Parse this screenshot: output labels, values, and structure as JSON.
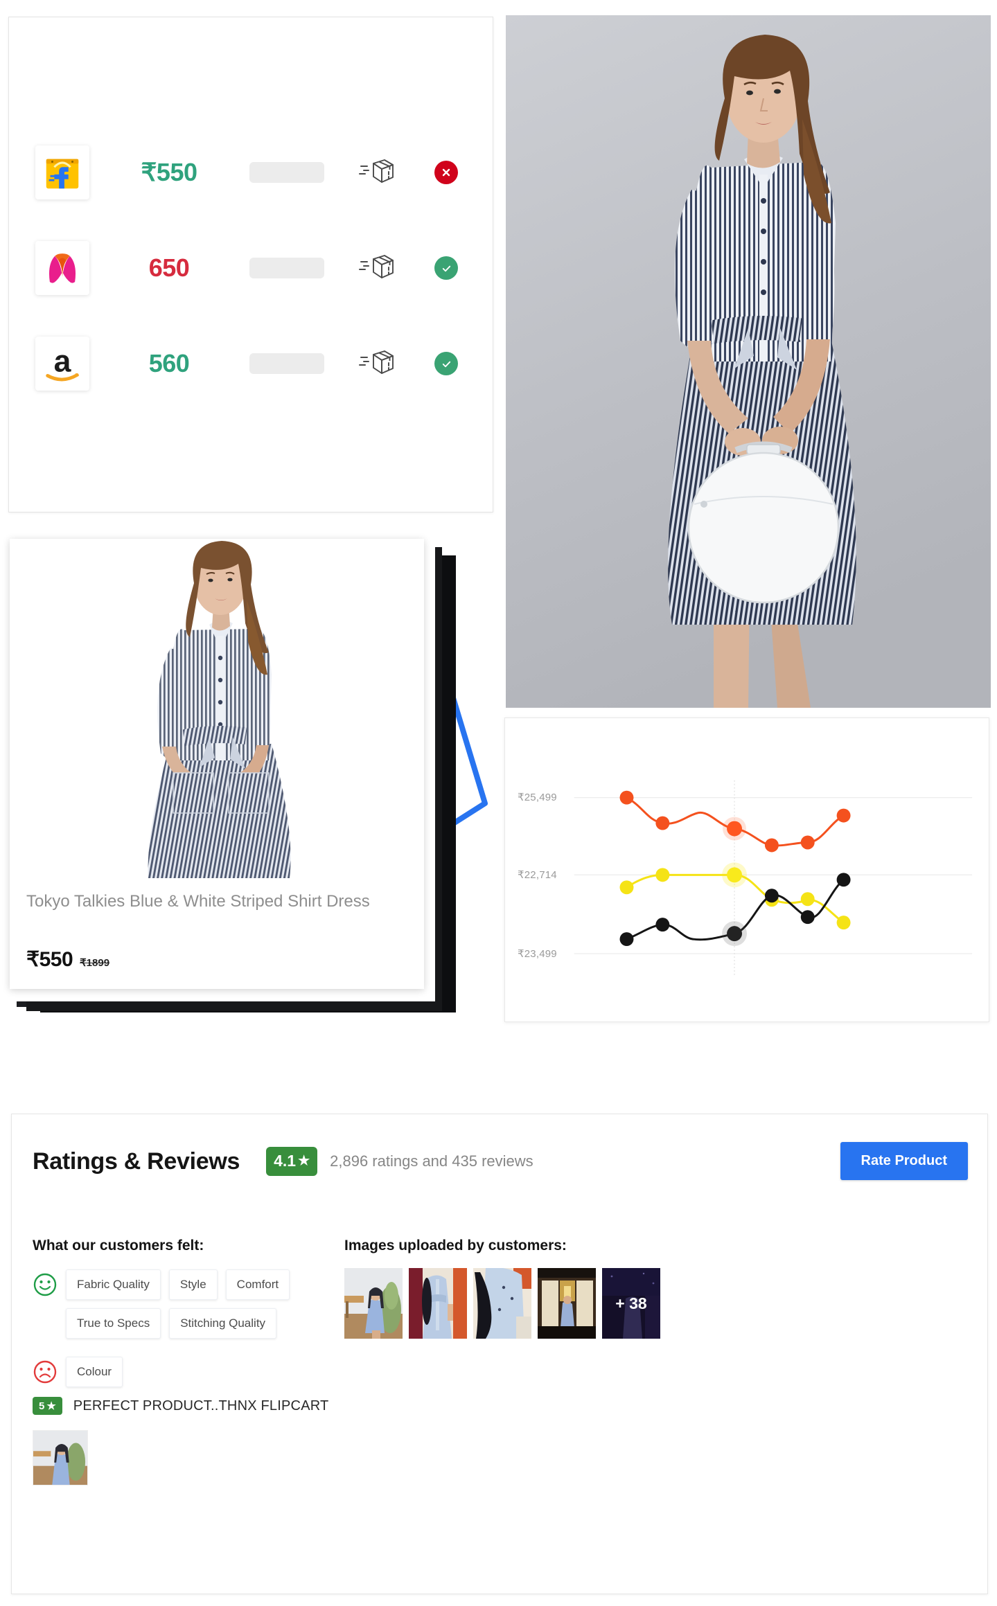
{
  "price_comparison": {
    "rows": [
      {
        "store": "flipkart",
        "store_label": "Flipkart",
        "price": "₹550",
        "price_color": "#2fa27d",
        "shipping_icon": "delivery-box-icon",
        "status": "unavailable",
        "status_icon": "cross-icon",
        "status_color": "#d0021b"
      },
      {
        "store": "myntra",
        "store_label": "Myntra",
        "price": "650",
        "price_color": "#d62b3e",
        "shipping_icon": "delivery-box-icon",
        "status": "available",
        "status_icon": "check-icon",
        "status_color": "#3aa373"
      },
      {
        "store": "amazon",
        "store_label": "Amazon",
        "price": "560",
        "price_color": "#2fa27d",
        "shipping_icon": "delivery-box-icon",
        "status": "available",
        "status_icon": "check-icon",
        "status_color": "#3aa373"
      }
    ]
  },
  "product_card": {
    "title": "Tokyo Talkies Blue & White Striped Shirt Dress",
    "price": "₹550",
    "original_price": "₹1899"
  },
  "chart_data": {
    "type": "line",
    "title": "",
    "xlabel": "",
    "ylabel": "",
    "grid": true,
    "legend_position": "none",
    "x": [
      1,
      2,
      3,
      4,
      5,
      6,
      7
    ],
    "ytick_labels": [
      "₹25,499",
      "₹22,714",
      "₹23,499"
    ],
    "ytick_values": [
      25499,
      22714,
      23499
    ],
    "series": [
      {
        "name": "Flipkart",
        "color": "#f4511e",
        "values": [
          25499,
          24950,
          25180,
          24620,
          24640,
          24640,
          25240
        ],
        "highlight_index": 2
      },
      {
        "name": "Myntra",
        "color": "#f5e316",
        "values": [
          22500,
          22714,
          22714,
          22100,
          22180,
          22130,
          21780
        ],
        "highlight_index": 2
      },
      {
        "name": "Amazon",
        "color": "#151515",
        "values": [
          21550,
          21780,
          21620,
          22180,
          21980,
          21760,
          22520
        ],
        "highlight_index": 2
      }
    ]
  },
  "reviews": {
    "title": "Ratings & Reviews",
    "rating_value": "4.1",
    "rating_star": "★",
    "rating_count_text": "2,896 ratings and 435 reviews",
    "rate_button_label": "Rate Product",
    "accent_color": "#2874f0",
    "badge_color": "#388e3c",
    "felt_label": "What our customers felt:",
    "images_label": "Images uploaded by customers:",
    "positive_icon": "smiley-happy-icon",
    "negative_icon": "smiley-sad-icon",
    "positive_tags_row1": [
      "Fabric Quality",
      "Style",
      "Comfort"
    ],
    "positive_tags_row2": [
      "True to Specs",
      "Stitching Quality"
    ],
    "negative_tags": [
      "Colour"
    ],
    "customer_images_more": "+ 38",
    "customer_image_count": 5,
    "top_review": {
      "stars": "5",
      "star_glyph": "★",
      "text": "PERFECT PRODUCT..THNX FLIPCART"
    }
  }
}
